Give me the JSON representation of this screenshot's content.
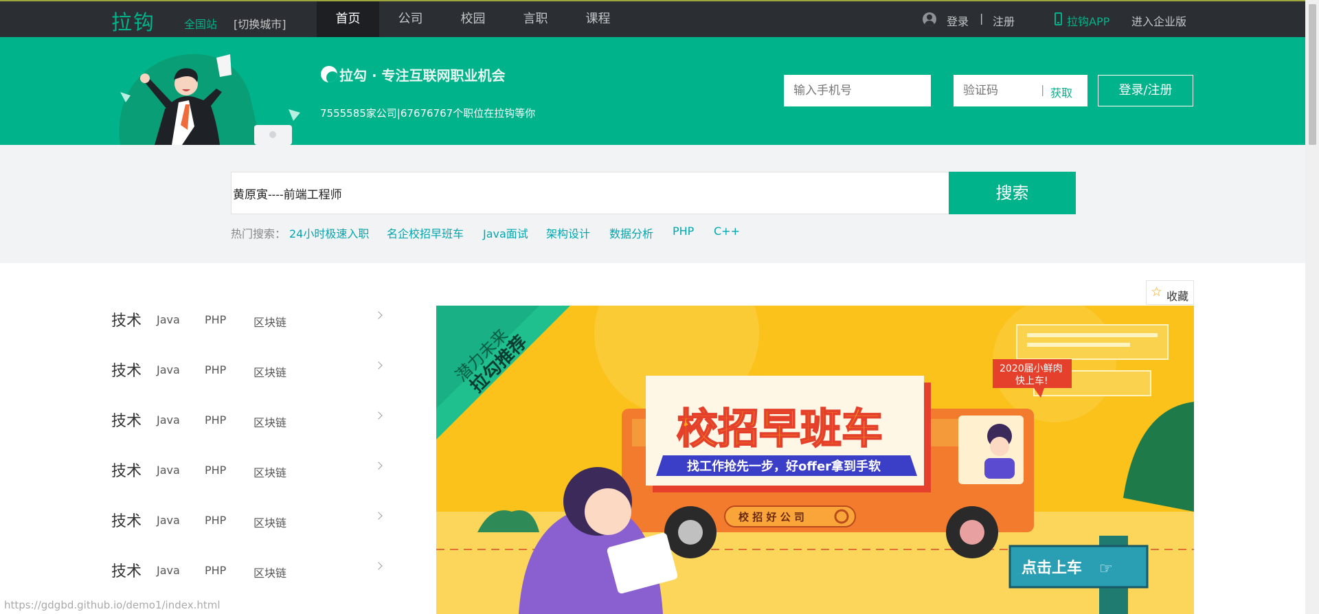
{
  "header": {
    "logo": "拉钩",
    "site": "全国站",
    "switch_city": "[切换城市]",
    "tabs": [
      {
        "label": "首页"
      },
      {
        "label": "公司"
      },
      {
        "label": "校园"
      },
      {
        "label": "言职"
      },
      {
        "label": "课程"
      }
    ],
    "login": "登录",
    "separator": "|",
    "register": "注册",
    "app": "拉钩APP",
    "enterprise": "进入企业版"
  },
  "banner": {
    "tagline": "拉勾 · 专注互联网职业机会",
    "stats": "7555585家公司|67676767个职位在拉钩等你",
    "phone_placeholder": "输入手机号",
    "code_placeholder": "验证码",
    "code_separator": "|",
    "get_code": "获取",
    "login_register": "登录/注册"
  },
  "search": {
    "value": "黄原寅----前端工程师",
    "button": "搜索",
    "hot_label": "热门搜索：",
    "hot": [
      {
        "label": "24小时极速入职"
      },
      {
        "label": "名企校招早班车"
      },
      {
        "label": "Java面试"
      },
      {
        "label": "架构设计"
      },
      {
        "label": "数据分析"
      },
      {
        "label": "PHP"
      },
      {
        "label": "C++"
      }
    ]
  },
  "categories": [
    {
      "title": "技术",
      "subs": [
        "Java",
        "PHP",
        "区块链"
      ]
    },
    {
      "title": "技术",
      "subs": [
        "Java",
        "PHP",
        "区块链"
      ]
    },
    {
      "title": "技术",
      "subs": [
        "Java",
        "PHP",
        "区块链"
      ]
    },
    {
      "title": "技术",
      "subs": [
        "Java",
        "PHP",
        "区块链"
      ]
    },
    {
      "title": "技术",
      "subs": [
        "Java",
        "PHP",
        "区块链"
      ]
    },
    {
      "title": "技术",
      "subs": [
        "Java",
        "PHP",
        "区块链"
      ]
    }
  ],
  "collect": "收藏",
  "promo": {
    "ribbon_line1": "潜力未来",
    "ribbon_line2": "拉勾推荐",
    "bubble_line1": "2020届小鲜肉",
    "bubble_line2": "快上车!",
    "title": "校招早班车",
    "subtitle": "找工作抢先一步，好offer拿到手软",
    "search_tag": "校 招 好 公 司",
    "cta": "点击上车"
  },
  "status_url": "https://gdgbd.github.io/demo1/index.html"
}
